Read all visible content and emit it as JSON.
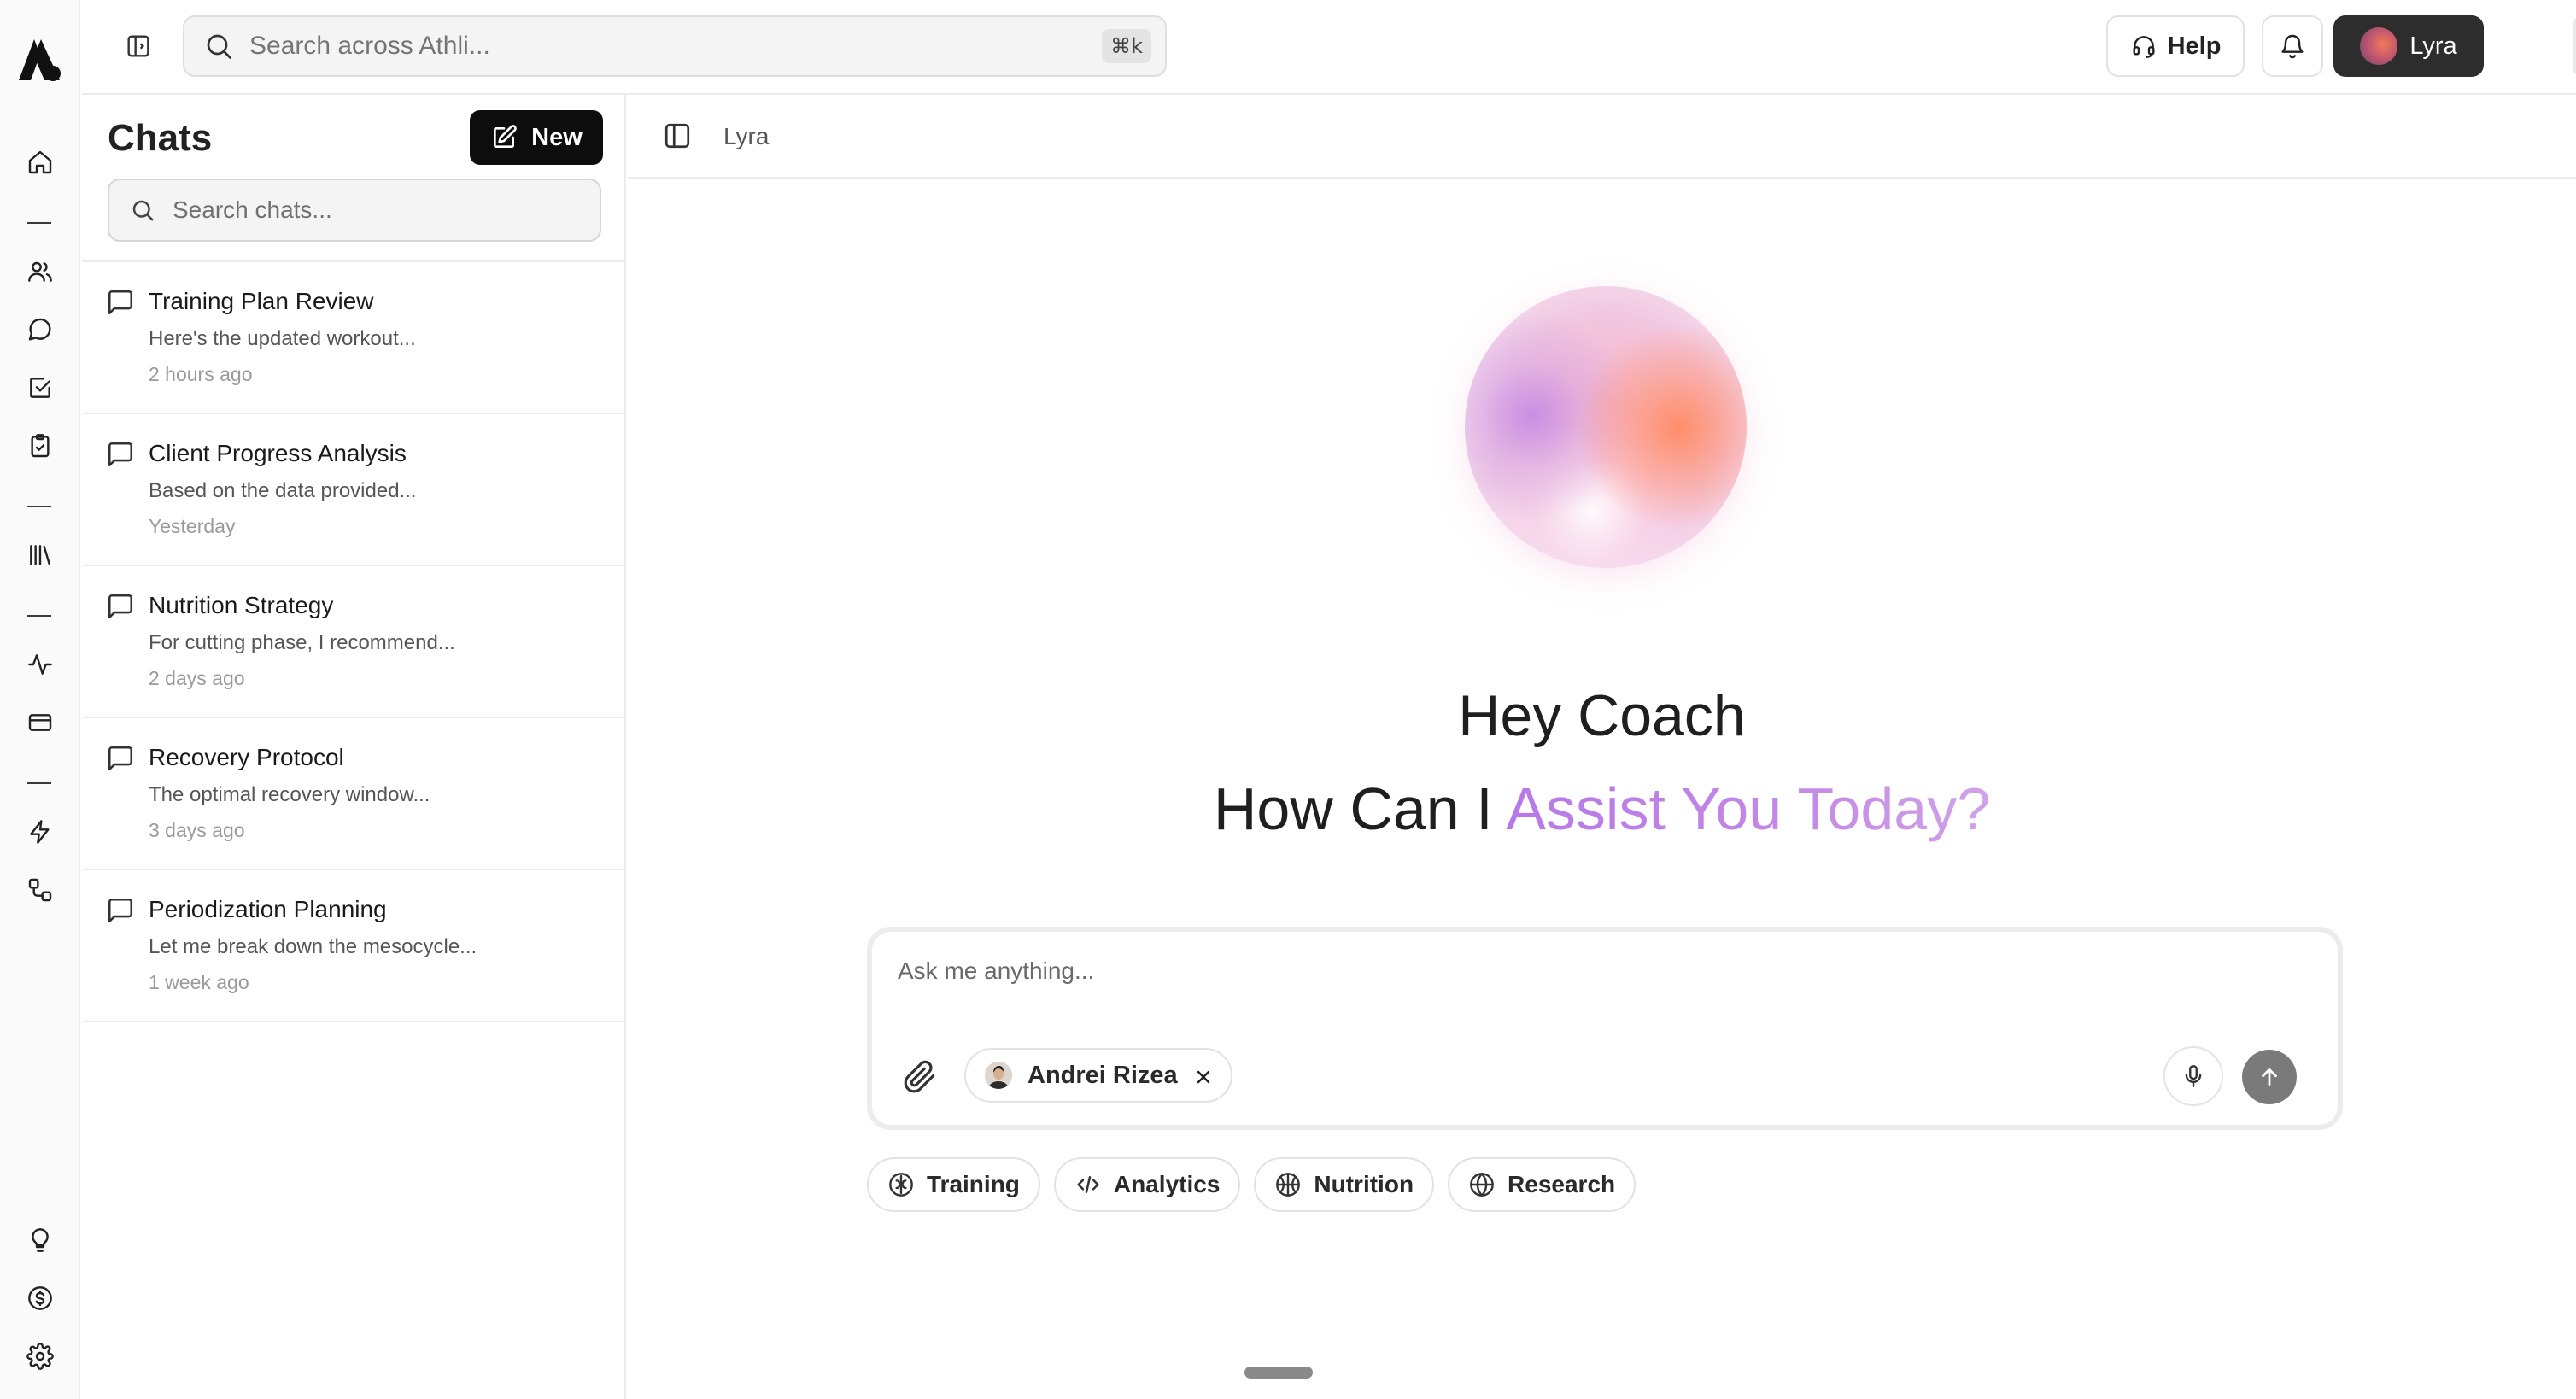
{
  "topbar": {
    "search_placeholder": "Search across Athli...",
    "search_shortcut": "⌘k",
    "help_label": "Help",
    "assistant_label": "Lyra"
  },
  "chats": {
    "title": "Chats",
    "new_label": "New",
    "search_placeholder": "Search chats...",
    "items": [
      {
        "title": "Training Plan Review",
        "preview": "Here's the updated workout...",
        "time": "2 hours ago"
      },
      {
        "title": "Client Progress Analysis",
        "preview": "Based on the data provided...",
        "time": "Yesterday"
      },
      {
        "title": "Nutrition Strategy",
        "preview": "For cutting phase, I recommend...",
        "time": "2 days ago"
      },
      {
        "title": "Recovery Protocol",
        "preview": "The optimal recovery window...",
        "time": "3 days ago"
      },
      {
        "title": "Periodization Planning",
        "preview": "Let me break down the mesocycle...",
        "time": "1 week ago"
      }
    ]
  },
  "main": {
    "breadcrumb": "Lyra",
    "greeting_line1": "Hey Coach",
    "greeting_line2_prefix": "How Can I ",
    "greeting_line2_accent": "Assist You Today?",
    "composer_placeholder": "Ask me anything...",
    "mention_name": "Andrei Rizea",
    "quick_actions": [
      {
        "label": "Training",
        "icon": "brain-icon"
      },
      {
        "label": "Analytics",
        "icon": "code-icon"
      },
      {
        "label": "Nutrition",
        "icon": "basketball-icon"
      },
      {
        "label": "Research",
        "icon": "globe-icon"
      }
    ]
  },
  "colors": {
    "accent_purple": "#b678e8",
    "send_button": "#7a7a7a",
    "dark_button": "#0d0d0d",
    "lyra_button": "#2d2d2d"
  }
}
